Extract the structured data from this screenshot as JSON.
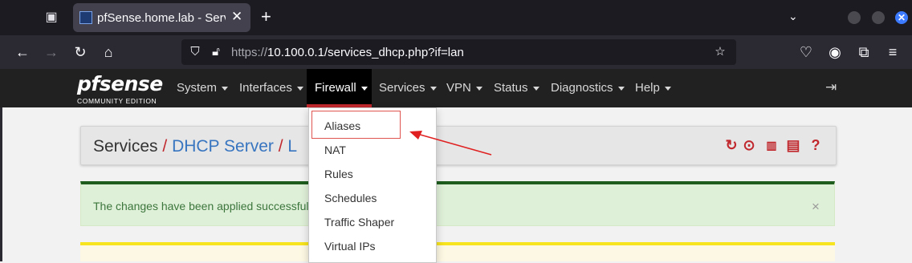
{
  "browser": {
    "tab_title": "pfSense.home.lab - Servic",
    "url_prefix": "https://",
    "url_host_path": "10.100.0.1/services_dhcp.php?if=lan",
    "close_symbol": "✕"
  },
  "pfsense": {
    "logo_text": "pfsense",
    "logo_sub": "COMMUNITY EDITION",
    "menu": [
      {
        "label": "System"
      },
      {
        "label": "Interfaces"
      },
      {
        "label": "Firewall"
      },
      {
        "label": "Services"
      },
      {
        "label": "VPN"
      },
      {
        "label": "Status"
      },
      {
        "label": "Diagnostics"
      },
      {
        "label": "Help"
      }
    ],
    "accent_color": "#c0282d"
  },
  "breadcrumb": {
    "services": "Services",
    "sep": "/",
    "dhcp_server": "DHCP Server",
    "lan": "L"
  },
  "alert": {
    "success_text": "The changes have been applied successfull",
    "close": "×"
  },
  "firewall_dropdown": {
    "items": [
      {
        "label": "Aliases"
      },
      {
        "label": "NAT"
      },
      {
        "label": "Rules"
      },
      {
        "label": "Schedules"
      },
      {
        "label": "Traffic Shaper"
      },
      {
        "label": "Virtual IPs"
      }
    ]
  }
}
